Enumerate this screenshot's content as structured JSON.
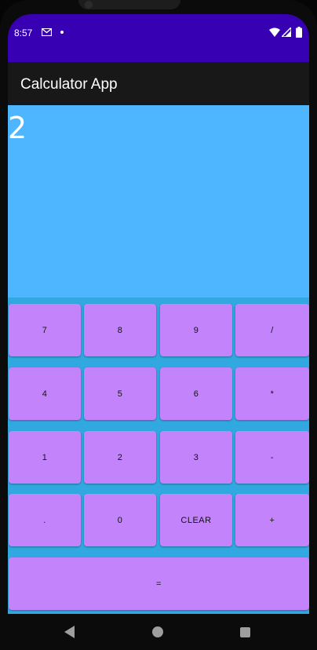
{
  "status_bar": {
    "time": "8:57",
    "icons": [
      "gmail-icon",
      "notification-dot-icon",
      "wifi-icon",
      "signal-icon",
      "battery-icon"
    ]
  },
  "app_bar": {
    "title": "Calculator App"
  },
  "display": {
    "value": "2"
  },
  "keypad": {
    "rows": [
      [
        "7",
        "8",
        "9",
        "/"
      ],
      [
        "4",
        "5",
        "6",
        "*"
      ],
      [
        "1",
        "2",
        "3",
        "-"
      ],
      [
        ".",
        "0",
        "CLEAR",
        "+"
      ],
      [
        "="
      ]
    ]
  },
  "nav_bar": {
    "icons": [
      "back-icon",
      "home-icon",
      "recents-icon"
    ]
  },
  "colors": {
    "status_bar": "#3700b3",
    "app_bar": "#181818",
    "display_bg": "#4db6ff",
    "keypad_bg": "#31a9e0",
    "key_bg": "#c384fb"
  }
}
